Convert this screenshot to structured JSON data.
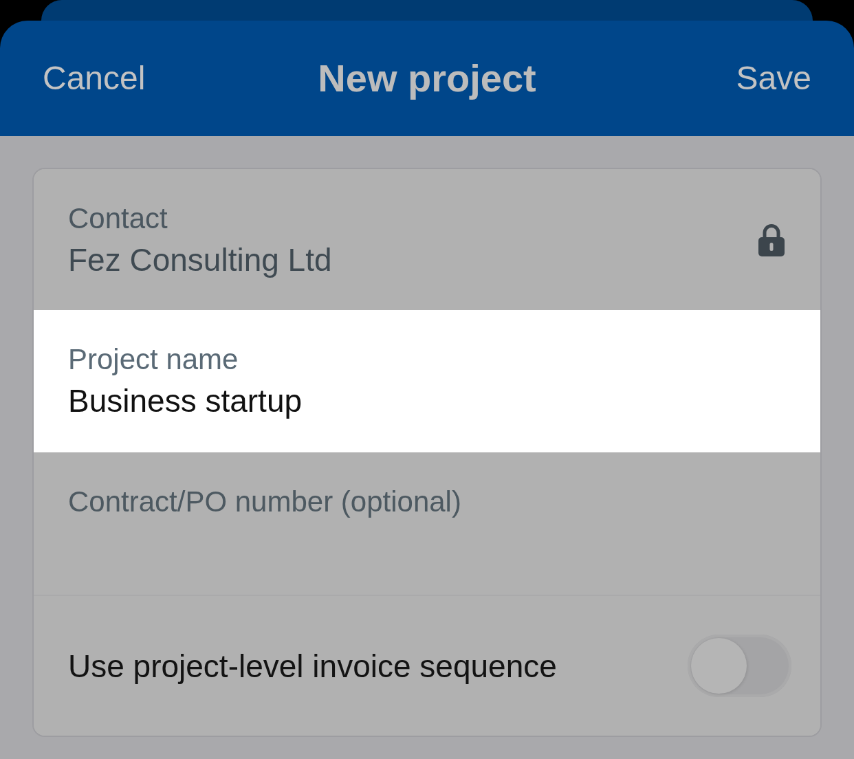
{
  "header": {
    "cancel": "Cancel",
    "title": "New project",
    "save": "Save"
  },
  "fields": [
    {
      "kind": "locked",
      "label": "Contact",
      "value": "Fez Consulting Ltd",
      "highlighted": false
    },
    {
      "kind": "text",
      "label": "Project name",
      "value": "Business startup",
      "highlighted": true
    },
    {
      "kind": "text",
      "placeholder": "Contract/PO number (optional)",
      "highlighted": false
    },
    {
      "kind": "toggle",
      "label": "Use project-level invoice sequence",
      "on": false,
      "highlighted": false
    }
  ]
}
